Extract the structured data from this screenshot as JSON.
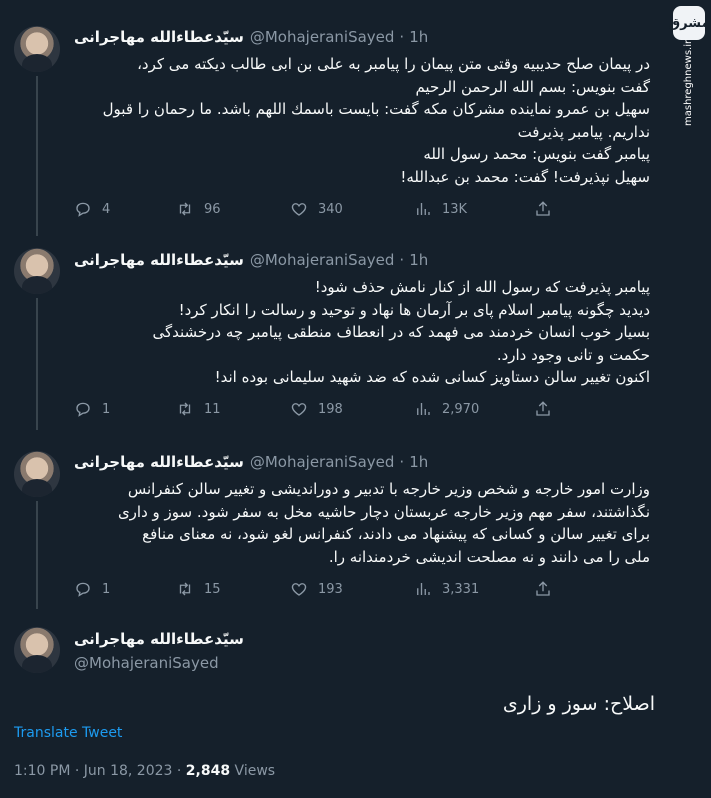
{
  "tweets": [
    {
      "name": "سیّدعطاءالله مهاجرانی",
      "handle": "@MohajeraniSayed",
      "time": "1h",
      "lines": [
        "در پیمان صلح حدیبیه وقتی متن پیمان را پیامبر به علی بن ابی طالب دیکته می کرد،",
        "گفت بنویس: بسم الله الرحمن الرحیم",
        "سهیل بن عمرو نماینده مشرکان مکه گفت: بایست باسمك اللهم باشد. ما رحمان را قبول",
        "نداریم. پیامبر پذیرفت",
        "پیامبر گفت بنویس: محمد رسول الله",
        "سهیل نپذیرفت! گفت: محمد بن عبدالله!"
      ],
      "replies": "4",
      "retweets": "96",
      "likes": "340",
      "views": "13K"
    },
    {
      "name": "سیّدعطاءالله مهاجرانی",
      "handle": "@MohajeraniSayed",
      "time": "1h",
      "lines": [
        "پیامبر پذیرفت که رسول الله از کنار نامش حذف شود!",
        "دیدید چگونه پیامبر اسلام پای بر آرمان ها نهاد و توحید و رسالت را انکار کرد!",
        "بسیار خوب انسان خردمند می فهمد که در انعطاف منطقی پیامبر چه درخشندگی",
        "حکمت و تانی وجود دارد.",
        "اکنون تغییر سالن دستاویز کسانی شده که ضد شهید سلیمانی بوده اند!"
      ],
      "replies": "1",
      "retweets": "11",
      "likes": "198",
      "views": "2,970"
    },
    {
      "name": "سیّدعطاءالله مهاجرانی",
      "handle": "@MohajeraniSayed",
      "time": "1h",
      "lines": [
        "وزارت امور خارجه و شخص وزیر خارجه با تدبیر و دوراندیشی و تغییر سالن کنفرانس",
        "نگذاشتند، سفر مهم وزیر خارجه عربستان دچار حاشیه مخل به سفر شود. سوز و داری",
        "برای تغییر سالن و کسانی که پیشنهاد می دادند، کنفرانس لغو شود، نه معنای منافع",
        "ملی را می دانند و نه مصلحت اندیشی خردمندانه را."
      ],
      "replies": "1",
      "retweets": "15",
      "likes": "193",
      "views": "3,331"
    }
  ],
  "main": {
    "name": "سیّدعطاءالله مهاجرانی",
    "handle": "@MohajeraniSayed",
    "text": "اصلاح: سوز و زاری",
    "translate": "Translate Tweet",
    "time": "1:10 PM · Jun 18, 2023 ·",
    "views_count": "2,848",
    "views_label": "Views"
  },
  "watermark": {
    "logo": "مشرق",
    "site": "mashreghnews.ir"
  },
  "colors": {
    "background": "#15202b",
    "text": "#f7f9f9",
    "muted": "#8b98a5",
    "link": "#1d9bf0"
  }
}
